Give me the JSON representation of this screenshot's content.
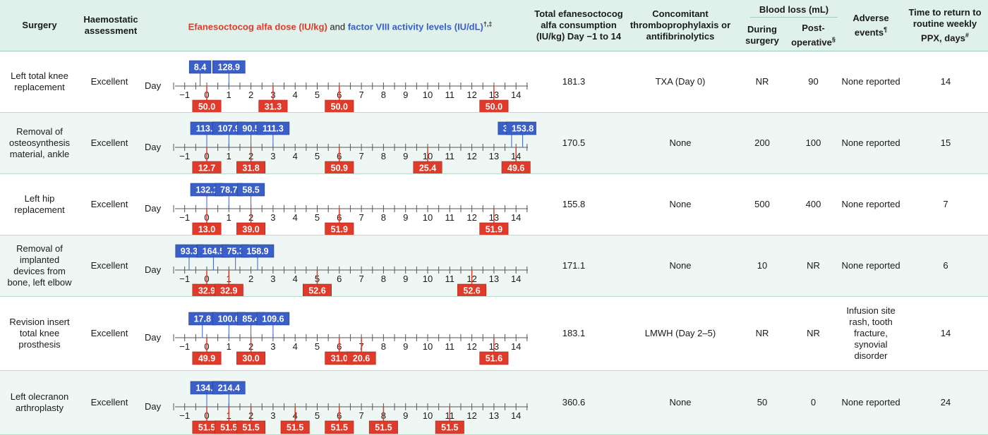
{
  "header": {
    "surgery": "Surgery",
    "haemostatic": "Haemostatic assessment",
    "dose_red": "Efanesoctocog alfa dose (IU/kg)",
    "dose_and": " and ",
    "dose_blue": "factor VIII activity levels (IU/dL)",
    "dose_marks": "†,‡",
    "total": "Total efanesoctocog alfa consumption (IU/kg) Day −1 to 14",
    "concomitant": "Concomitant thromboprophylaxis or antifibrinolytics",
    "blood_loss": "Blood loss (mL)",
    "during": "During surgery",
    "post": "Post-operative",
    "post_mark": "§",
    "adverse": "Adverse events",
    "adverse_mark": "¶",
    "time_return": "Time to return to routine weekly PPX, days",
    "time_mark": "#"
  },
  "day_label": "Day",
  "ticks": [
    "−1",
    "0",
    "1",
    "2",
    "3",
    "4",
    "5",
    "6",
    "7",
    "8",
    "9",
    "10",
    "11",
    "12",
    "13",
    "14"
  ],
  "colors": {
    "dose": "#e03b2a",
    "fviii": "#3a5fc8",
    "header_bg": "#dff1ea",
    "alt_row": "#eef7f3"
  },
  "rows": [
    {
      "surgery": "Left total knee replacement",
      "haemostatic": "Excellent",
      "fviii": [
        {
          "day": -0.3,
          "value": "8.4"
        },
        {
          "day": 1.0,
          "value": "128.9"
        }
      ],
      "doses": [
        {
          "day": 0.0,
          "value": "50.0"
        },
        {
          "day": 3.0,
          "value": "31.3"
        },
        {
          "day": 6.0,
          "value": "50.0"
        },
        {
          "day": 13.0,
          "value": "50.0"
        }
      ],
      "total": "181.3",
      "concomitant": "TXA (Day 0)",
      "during": "NR",
      "post": "90",
      "adverse": "None reported",
      "time": "14"
    },
    {
      "surgery": "Removal of osteosynthesis material, ankle",
      "haemostatic": "Excellent",
      "fviii": [
        {
          "day": 0.0,
          "value": "113.1"
        },
        {
          "day": 1.0,
          "value": "107.9"
        },
        {
          "day": 2.0,
          "value": "90.5"
        },
        {
          "day": 3.0,
          "value": "111.3"
        },
        {
          "day": 13.8,
          "value": "36.4"
        },
        {
          "day": 14.3,
          "value": "153.8"
        }
      ],
      "doses": [
        {
          "day": 0.0,
          "value": "12.7"
        },
        {
          "day": 2.0,
          "value": "31.8"
        },
        {
          "day": 6.0,
          "value": "50.9"
        },
        {
          "day": 10.0,
          "value": "25.4"
        },
        {
          "day": 14.0,
          "value": "49.6"
        }
      ],
      "total": "170.5",
      "concomitant": "None",
      "during": "200",
      "post": "100",
      "adverse": "None reported",
      "time": "15"
    },
    {
      "surgery": "Left hip replacement",
      "haemostatic": "Excellent",
      "fviii": [
        {
          "day": 0.0,
          "value": "132.1"
        },
        {
          "day": 1.0,
          "value": "78.7"
        },
        {
          "day": 2.0,
          "value": "58.5"
        }
      ],
      "doses": [
        {
          "day": 0.0,
          "value": "13.0"
        },
        {
          "day": 2.0,
          "value": "39.0"
        },
        {
          "day": 6.0,
          "value": "51.9"
        },
        {
          "day": 13.0,
          "value": "51.9"
        }
      ],
      "total": "155.8",
      "concomitant": "None",
      "during": "500",
      "post": "400",
      "adverse": "None reported",
      "time": "7"
    },
    {
      "surgery": "Removal of implanted devices from bone, left elbow",
      "haemostatic": "Excellent",
      "fviii": [
        {
          "day": -0.8,
          "value": "93.3"
        },
        {
          "day": 0.3,
          "value": "164.5"
        },
        {
          "day": 1.3,
          "value": "75.3"
        },
        {
          "day": 2.3,
          "value": "158.9"
        }
      ],
      "doses": [
        {
          "day": 0.0,
          "value": "32.9"
        },
        {
          "day": 1.0,
          "value": "32.9"
        },
        {
          "day": 5.0,
          "value": "52.6"
        },
        {
          "day": 12.0,
          "value": "52.6"
        }
      ],
      "total": "171.1",
      "concomitant": "None",
      "during": "10",
      "post": "NR",
      "adverse": "None reported",
      "time": "6"
    },
    {
      "surgery": "Revision insert total knee prosthesis",
      "haemostatic": "Excellent",
      "fviii": [
        {
          "day": -0.2,
          "value": "17.8"
        },
        {
          "day": 1.0,
          "value": "100.6"
        },
        {
          "day": 2.0,
          "value": "85.4"
        },
        {
          "day": 3.0,
          "value": "109.6"
        }
      ],
      "doses": [
        {
          "day": 0.0,
          "value": "49.9"
        },
        {
          "day": 2.0,
          "value": "30.0"
        },
        {
          "day": 6.0,
          "value": "31.0"
        },
        {
          "day": 7.0,
          "value": "20.6"
        },
        {
          "day": 13.0,
          "value": "51.6"
        }
      ],
      "total": "183.1",
      "concomitant": "LMWH (Day 2–5)",
      "during": "NR",
      "post": "NR",
      "adverse": "Infusion site rash, tooth fracture, synovial disorder",
      "time": "14"
    },
    {
      "surgery": "Left olecranon arthroplasty",
      "haemostatic": "Excellent",
      "fviii": [
        {
          "day": 0.0,
          "value": "134.6"
        },
        {
          "day": 1.0,
          "value": "214.4"
        }
      ],
      "doses": [
        {
          "day": 0.0,
          "value": "51.5"
        },
        {
          "day": 1.0,
          "value": "51.5"
        },
        {
          "day": 2.0,
          "value": "51.5"
        },
        {
          "day": 4.0,
          "value": "51.5"
        },
        {
          "day": 6.0,
          "value": "51.5"
        },
        {
          "day": 8.0,
          "value": "51.5"
        },
        {
          "day": 11.0,
          "value": "51.5"
        }
      ],
      "total": "360.6",
      "concomitant": "None",
      "during": "50",
      "post": "0",
      "adverse": "None reported",
      "time": "24"
    }
  ]
}
